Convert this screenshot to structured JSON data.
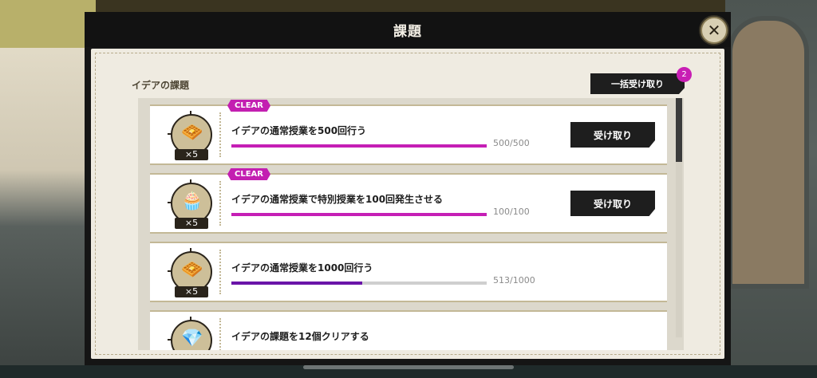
{
  "window": {
    "title": "課題"
  },
  "section": {
    "title": "イデアの課題"
  },
  "bulk_receive": {
    "label": "一括受け取り",
    "badge": "2"
  },
  "tasks": [
    {
      "icon": "waffle-icon",
      "count": "×5",
      "clear": "CLEAR",
      "label": "イデアの通常授業を500回行う",
      "progress": "500/500",
      "ratio": 1.0,
      "bar_color": "#c51fb5",
      "button": "受け取り"
    },
    {
      "icon": "cupcake-icon",
      "count": "×5",
      "clear": "CLEAR",
      "label": "イデアの通常授業で特別授業を100回発生させる",
      "progress": "100/100",
      "ratio": 1.0,
      "bar_color": "#c51fb5",
      "button": "受け取り"
    },
    {
      "icon": "waffle-icon",
      "count": "×5",
      "label": "イデアの通常授業を1000回行う",
      "progress": "513/1000",
      "ratio": 0.513,
      "bar_color": "#6a14a8"
    },
    {
      "icon": "purple-gem-icon",
      "label": "イデアの課題を12個クリアする"
    }
  ],
  "colors": {
    "accent": "#c51fb5",
    "progress_partial": "#6a14a8"
  }
}
